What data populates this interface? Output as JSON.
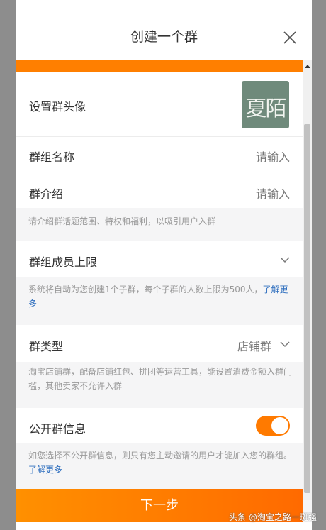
{
  "dialog": {
    "title": "创建一个群"
  },
  "form": {
    "avatar_label": "设置群头像",
    "avatar_image_text": "夏陌",
    "group_name_label": "群组名称",
    "group_name_placeholder": "请输入",
    "intro_label": "群介绍",
    "intro_placeholder": "请输入",
    "intro_hint": "请介绍群话题范围、特权和福利，以吸引用户入群",
    "member_limit_label": "群组成员上限",
    "member_limit_hint": "系统将自动为您创建1个子群，每个子群的人数上限为500人，",
    "member_limit_link": "了解更多",
    "type_label": "群类型",
    "type_value": "店铺群",
    "type_hint": "淘宝店铺群，配备店铺红包、拼团等运营工具，能设置消费金额入群门槛，其他卖家不允许入群",
    "public_label": "公开群信息",
    "public_enabled": true,
    "public_hint": "如您选择不公开群信息，则只有您主动邀请的用户才能加入您的群组。",
    "public_link": "了解更多"
  },
  "footer": {
    "next_label": "下一步"
  },
  "watermark": "头条 @淘宝之路一斑强",
  "colors": {
    "accent": "#ff7f00",
    "link": "#2f6fbf",
    "hint_text": "#999999",
    "avatar_bg": "#6f8a7b"
  }
}
